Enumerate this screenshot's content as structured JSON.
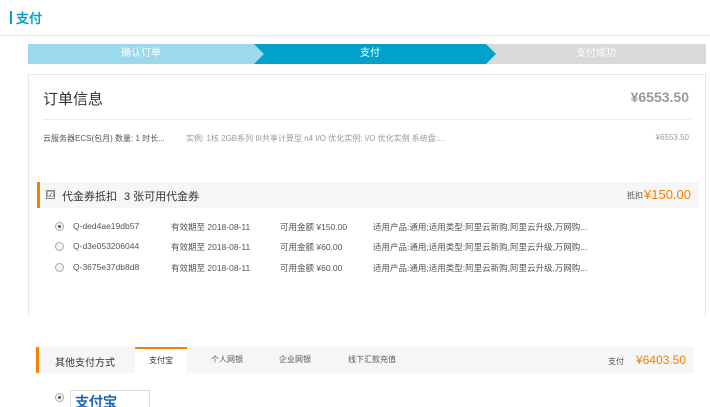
{
  "header": {
    "title": "支付"
  },
  "steps": [
    {
      "label": "确认订单",
      "state": "done"
    },
    {
      "label": "支付",
      "state": "active"
    },
    {
      "label": "支付成功",
      "state": "pending"
    }
  ],
  "order": {
    "title": "订单信息",
    "total": "¥6553.50",
    "item": "云服务器ECS(包月) 数量: 1 时长...",
    "spec": "实例: 1核 2GB系列 III共享计算型 n4 I/O 优化实例: I/O 优化实例 系统盘:...",
    "price": "¥6553.50"
  },
  "coupon": {
    "checkbox": "☑",
    "label": "代金券抵扣",
    "count": "3 张可用代金券",
    "deduct_label": "抵扣",
    "deduct_value": "¥150.00",
    "rows": [
      {
        "code": "Q-ded4ae19db57",
        "expire": "有效期至 2018-08-11",
        "amount": "可用金额 ¥150.00",
        "scope": "适用产品:通用;适用类型:阿里云新购,阿里云升级,万网购...",
        "selected": true
      },
      {
        "code": "Q-d3e053206044",
        "expire": "有效期至 2018-08-11",
        "amount": "可用金额 ¥60.00",
        "scope": "适用产品:通用;适用类型:阿里云新购,阿里云升级,万网购...",
        "selected": false
      },
      {
        "code": "Q-3675e37db8d8",
        "expire": "有效期至 2018-08-11",
        "amount": "可用金额 ¥60.00",
        "scope": "适用产品:通用;适用类型:阿里云新购,阿里云升级,万网购...",
        "selected": false
      }
    ]
  },
  "payment": {
    "label": "其他支付方式",
    "tabs": [
      {
        "label": "支付宝",
        "active": true
      },
      {
        "label": "个人网银",
        "active": false
      },
      {
        "label": "企业网银",
        "active": false
      },
      {
        "label": "线下汇款充值",
        "active": false
      }
    ],
    "sum_label": "支付",
    "sum_value": "¥6403.50",
    "method_logo_text": "支付宝"
  },
  "colors": {
    "accent": "#00a2ca",
    "orange": "#f08200",
    "step_done": "#9bd9ee",
    "step_pending": "#d9d9d9"
  }
}
